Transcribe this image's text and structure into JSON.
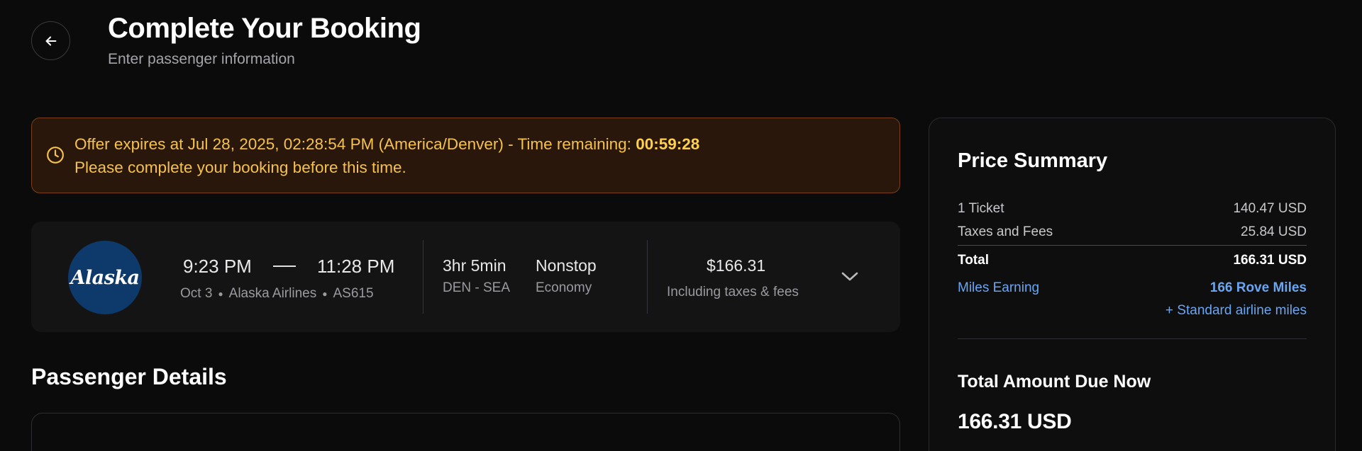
{
  "header": {
    "title": "Complete Your Booking",
    "subtitle": "Enter passenger information"
  },
  "offer": {
    "message": "Offer expires at Jul 28, 2025, 02:28:54 PM (America/Denver) - Time remaining: ",
    "time_remaining": "00:59:28",
    "instruction": "Please complete your booking before this time.",
    "color": "#f5c24b"
  },
  "flight": {
    "airline_logo_text": "Alaska",
    "departure_time": "9:23 PM",
    "arrival_time": "11:28 PM",
    "date": "Oct 3",
    "airline": "Alaska Airlines",
    "flight_number": "AS615",
    "duration": "3hr 5min",
    "route": "DEN - SEA",
    "stops": "Nonstop",
    "cabin": "Economy",
    "price": "$166.31",
    "price_note": "Including taxes & fees",
    "brand_color": "#0e3a6b"
  },
  "passenger_section": {
    "title": "Passenger Details"
  },
  "price_summary": {
    "title": "Price Summary",
    "ticket_label": "1 Ticket",
    "ticket_value": "140.47 USD",
    "taxes_label": "Taxes and Fees",
    "taxes_value": "25.84 USD",
    "total_label": "Total",
    "total_value": "166.31 USD",
    "miles_label": "Miles Earning",
    "miles_value": "166 Rove Miles",
    "standard_miles": "+ Standard airline miles",
    "due_label": "Total Amount Due Now",
    "due_value": "166.31 USD",
    "accent_color": "#6aa6f0"
  },
  "icons": {
    "back": "arrow-left-icon",
    "clock": "clock-icon",
    "expand": "chevron-down-icon"
  }
}
